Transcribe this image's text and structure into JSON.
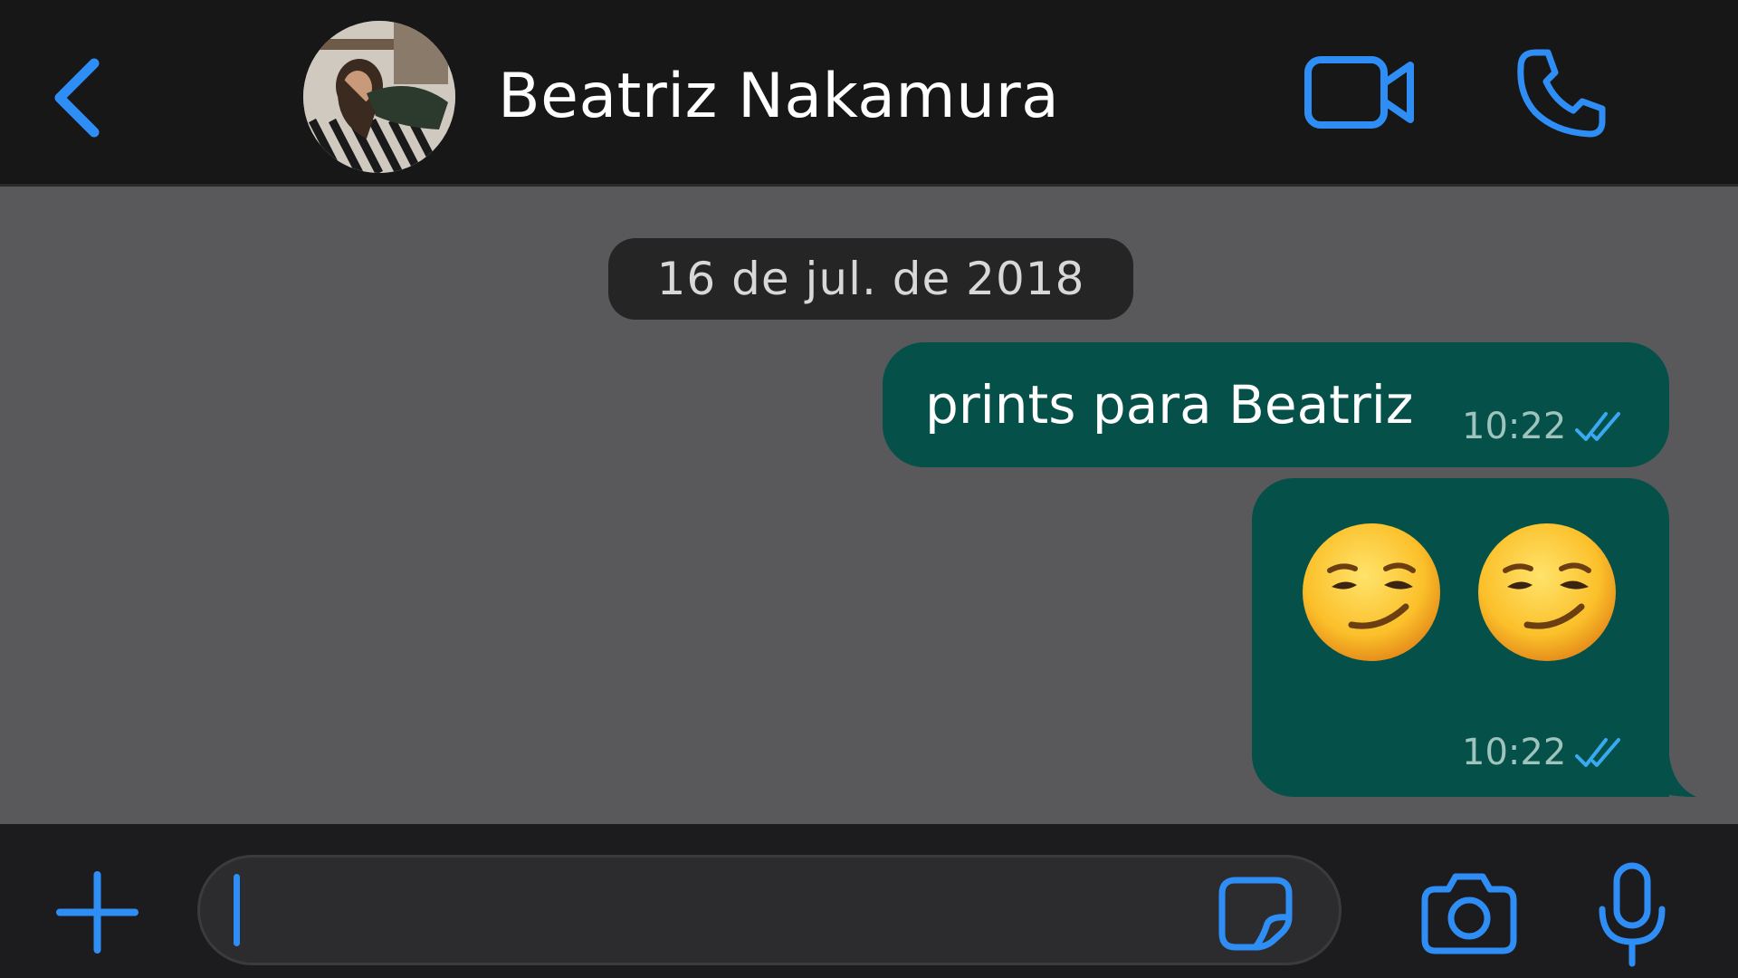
{
  "header": {
    "contact_name": "Beatriz Nakamura",
    "icons": {
      "back": "chevron-left-icon",
      "video": "video-camera-icon",
      "call": "phone-icon"
    }
  },
  "chat": {
    "date_label": "16 de jul. de 2018",
    "messages": [
      {
        "direction": "outgoing",
        "text": "prints para Beatriz",
        "time": "10:22",
        "status": "read"
      },
      {
        "direction": "outgoing",
        "emojis": [
          "smirking-face",
          "smirking-face"
        ],
        "time": "10:22",
        "status": "read"
      }
    ]
  },
  "input_bar": {
    "message_value": "",
    "placeholder": "",
    "icons": {
      "attach": "plus-icon",
      "sticker": "sticker-icon",
      "camera": "camera-icon",
      "mic": "microphone-icon"
    }
  },
  "colors": {
    "accent": "#2f8ef5",
    "header_bg": "#171717",
    "chat_bg": "#59595b",
    "bubble_outgoing": "#05514a",
    "date_pill": "#252525",
    "input_bar_bg": "#1c1c1e"
  }
}
